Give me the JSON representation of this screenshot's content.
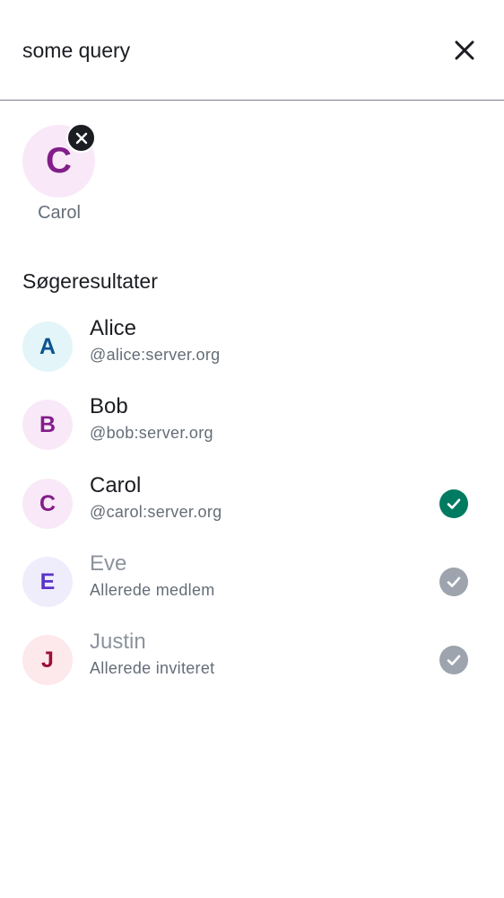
{
  "search": {
    "query": "some query"
  },
  "selected": [
    {
      "initial": "C",
      "name": "Carol"
    }
  ],
  "section_title": "Søgeresultater",
  "results": [
    {
      "initial": "A",
      "name": "Alice",
      "sub": "@alice:server.org",
      "state": "none",
      "avatar_bg": "#e3f5f9",
      "avatar_fg": "#0b5390"
    },
    {
      "initial": "B",
      "name": "Bob",
      "sub": "@bob:server.org",
      "state": "none",
      "avatar_bg": "#f9e9f8",
      "avatar_fg": "#821e89"
    },
    {
      "initial": "C",
      "name": "Carol",
      "sub": "@carol:server.org",
      "state": "selected",
      "avatar_bg": "#f9e9f8",
      "avatar_fg": "#821e89"
    },
    {
      "initial": "E",
      "name": "Eve",
      "sub": "Allerede medlem",
      "state": "disabled",
      "avatar_bg": "#efedfc",
      "avatar_fg": "#5b33c8"
    },
    {
      "initial": "J",
      "name": "Justin",
      "sub": "Allerede inviteret",
      "state": "disabled",
      "avatar_bg": "#fde8ec",
      "avatar_fg": "#9b1036"
    }
  ],
  "colors": {
    "selected_check": "#007a61",
    "disabled_check": "#9da4ae"
  },
  "icons": {
    "clear": "close-icon",
    "chip_remove": "close-icon",
    "check": "checkmark-icon"
  }
}
